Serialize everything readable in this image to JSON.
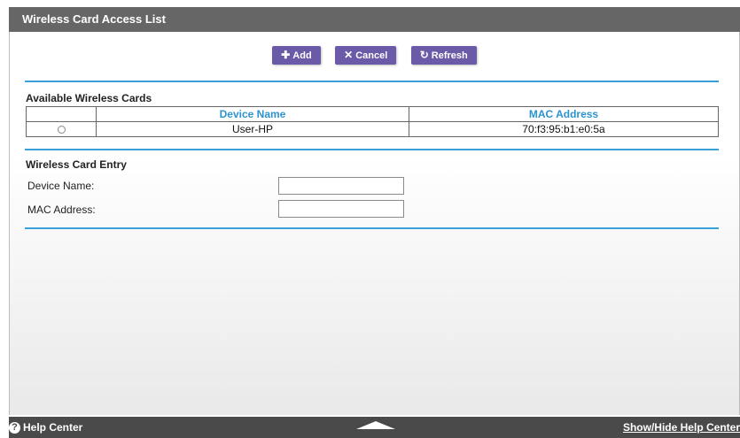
{
  "header": {
    "title": "Wireless Card Access List"
  },
  "toolbar": {
    "add_label": "Add",
    "cancel_label": "Cancel",
    "refresh_label": "Refresh",
    "button_color": "#6a5aa8"
  },
  "available": {
    "title": "Available Wireless Cards",
    "columns": [
      "Device Name",
      "MAC Address"
    ],
    "rows": [
      {
        "device_name": "User-HP",
        "mac_address": "70:f3:95:b1:e0:5a",
        "selected": false
      }
    ]
  },
  "entry": {
    "title": "Wireless Card Entry",
    "device_name_label": "Device Name:",
    "device_name_value": "",
    "mac_address_label": "MAC Address:",
    "mac_address_value": ""
  },
  "footer": {
    "help_label": "Help Center",
    "toggle_label": "Show/Hide Help Center"
  },
  "colors": {
    "accent": "#3aa0d8",
    "titlebar": "#666666",
    "footer": "#4a4a4a"
  }
}
